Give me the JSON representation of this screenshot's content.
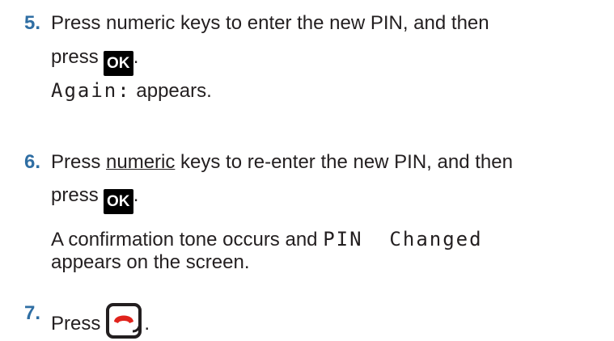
{
  "steps": [
    {
      "number": "5.",
      "line1": "Press numeric keys to enter the new PIN, and then",
      "line2_prefix": "press",
      "key_label": "OK",
      "line2_suffix": ".",
      "result_code": "Again:",
      "result_text": " appears."
    },
    {
      "number": "6.",
      "line1_pre": "Press ",
      "line1_underlined": "numeric",
      "line1_post": " keys to re-enter the new PIN, and then",
      "line2_prefix": "press",
      "key_label": "OK",
      "line2_suffix": ".",
      "result_line1_text": "A confirmation tone occurs and ",
      "result_line1_code": "PIN  Changed",
      "result_line2": "appears on the screen."
    },
    {
      "number": "7.",
      "text": "Press",
      "suffix": ".",
      "key_icon": "end-call-icon"
    }
  ],
  "colors": {
    "step_number": "#2f6ea3",
    "text": "#231f20",
    "end_icon_red": "#e0231c"
  }
}
